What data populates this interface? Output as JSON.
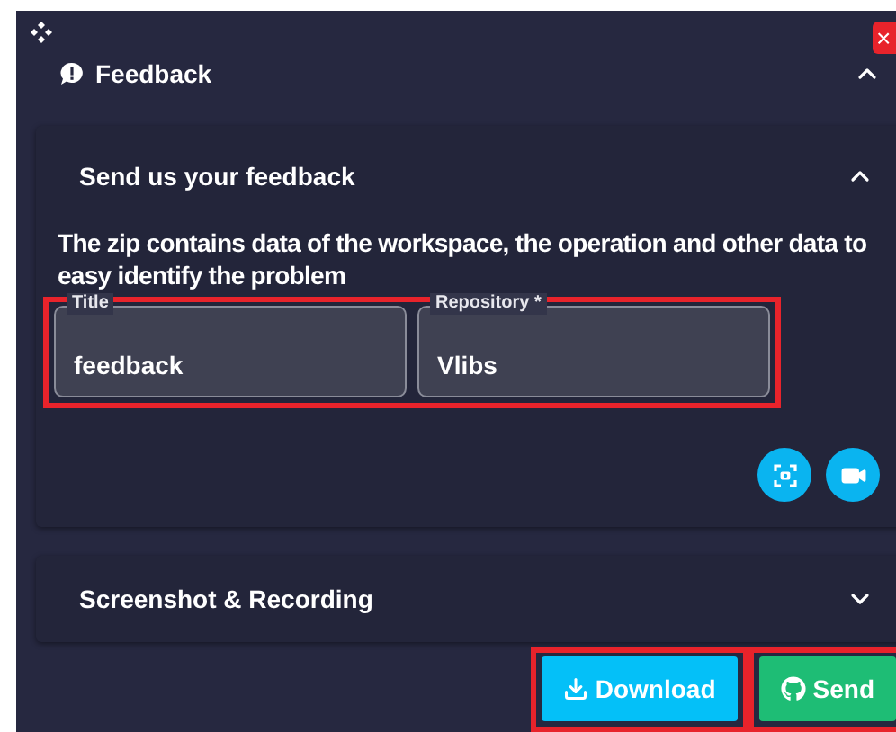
{
  "window": {
    "close_label": "×"
  },
  "panel": {
    "title": "Feedback",
    "expanded": true
  },
  "sections": [
    {
      "kind": "form",
      "title": "Send us your feedback",
      "expanded": true,
      "description": "The zip contains data of the workspace, the operation and other data to easy identify the problem",
      "fields_highlighted": true,
      "fields": [
        {
          "label": "Title",
          "value": "feedback"
        },
        {
          "label": "Repository *",
          "value": "Vlibs"
        }
      ]
    },
    {
      "kind": "collapsed",
      "title": "Screenshot & Recording",
      "expanded": false
    }
  ],
  "buttons": [
    {
      "kind": "download",
      "label": "Download",
      "highlighted": true
    },
    {
      "kind": "send",
      "label": "Send",
      "highlighted": true
    }
  ]
}
